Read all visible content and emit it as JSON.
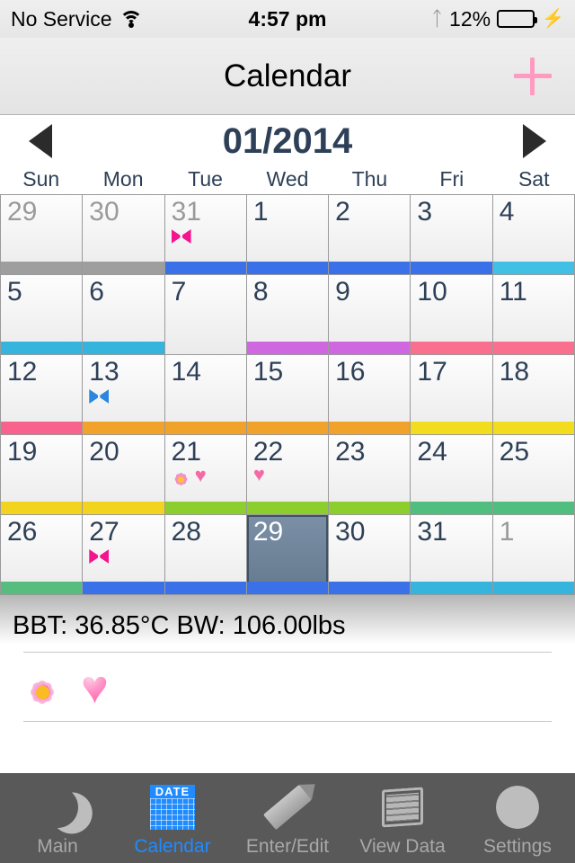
{
  "status_bar": {
    "carrier": "No Service",
    "wifi_icon": "wifi-icon",
    "time": "4:57 pm",
    "bluetooth_icon": "bluetooth-icon",
    "battery_percent": "12%",
    "battery_level": 12,
    "charging_icon": "lightning-bolt-icon"
  },
  "nav_bar": {
    "title": "Calendar",
    "add_icon": "plus-icon",
    "add_color": "#ff9bc0"
  },
  "month_header": {
    "prev_icon": "left-triangle-icon",
    "label": "01/2014",
    "next_icon": "right-triangle-icon"
  },
  "weekdays": [
    "Sun",
    "Mon",
    "Tue",
    "Wed",
    "Thu",
    "Fri",
    "Sat"
  ],
  "calendar": {
    "weeks": [
      [
        {
          "day": "29",
          "dim": true,
          "selected": false,
          "bar": "#9e9e9e",
          "marks": []
        },
        {
          "day": "30",
          "dim": true,
          "selected": false,
          "bar": "#9e9e9e",
          "marks": []
        },
        {
          "day": "31",
          "dim": true,
          "selected": false,
          "bar": "#3b71e8",
          "marks": [
            "bow-pink"
          ]
        },
        {
          "day": "1",
          "dim": false,
          "selected": false,
          "bar": "#3b71e8",
          "marks": []
        },
        {
          "day": "2",
          "dim": false,
          "selected": false,
          "bar": "#3b71e8",
          "marks": []
        },
        {
          "day": "3",
          "dim": false,
          "selected": false,
          "bar": "#3b71e8",
          "marks": []
        },
        {
          "day": "4",
          "dim": false,
          "selected": false,
          "bar": "#41bfe5",
          "marks": []
        }
      ],
      [
        {
          "day": "5",
          "dim": false,
          "selected": false,
          "bar": "#35b4dd",
          "marks": []
        },
        {
          "day": "6",
          "dim": false,
          "selected": false,
          "bar": "#35b4dd",
          "marks": []
        },
        {
          "day": "7",
          "dim": false,
          "selected": false,
          "bar": "#d濃",
          "marks": []
        },
        {
          "day": "8",
          "dim": false,
          "selected": false,
          "bar": "#cf68e0",
          "marks": []
        },
        {
          "day": "9",
          "dim": false,
          "selected": false,
          "bar": "#cf68e0",
          "marks": []
        },
        {
          "day": "10",
          "dim": false,
          "selected": false,
          "bar": "#fa6f8e",
          "marks": []
        },
        {
          "day": "11",
          "dim": false,
          "selected": false,
          "bar": "#fa6f8e",
          "marks": []
        }
      ],
      [
        {
          "day": "12",
          "dim": false,
          "selected": false,
          "bar": "#f7638d",
          "marks": []
        },
        {
          "day": "13",
          "dim": false,
          "selected": false,
          "bar": "#f0a22a",
          "marks": [
            "bow-blue"
          ]
        },
        {
          "day": "14",
          "dim": false,
          "selected": false,
          "bar": "#f0a22a",
          "marks": []
        },
        {
          "day": "15",
          "dim": false,
          "selected": false,
          "bar": "#f0a22a",
          "marks": []
        },
        {
          "day": "16",
          "dim": false,
          "selected": false,
          "bar": "#f0a22a",
          "marks": []
        },
        {
          "day": "17",
          "dim": false,
          "selected": false,
          "bar": "#f2dc1e",
          "marks": []
        },
        {
          "day": "18",
          "dim": false,
          "selected": false,
          "bar": "#f2dc1e",
          "marks": []
        }
      ],
      [
        {
          "day": "19",
          "dim": false,
          "selected": false,
          "bar": "#f2d41e",
          "marks": []
        },
        {
          "day": "20",
          "dim": false,
          "selected": false,
          "bar": "#f2d41e",
          "marks": []
        },
        {
          "day": "21",
          "dim": false,
          "selected": false,
          "bar": "#8cce2e",
          "marks": [
            "flower",
            "heart"
          ]
        },
        {
          "day": "22",
          "dim": false,
          "selected": false,
          "bar": "#8cce2e",
          "marks": [
            "heart"
          ]
        },
        {
          "day": "23",
          "dim": false,
          "selected": false,
          "bar": "#8cce2e",
          "marks": []
        },
        {
          "day": "24",
          "dim": false,
          "selected": false,
          "bar": "#4fbe7e",
          "marks": []
        },
        {
          "day": "25",
          "dim": false,
          "selected": false,
          "bar": "#4fbe7e",
          "marks": []
        }
      ],
      [
        {
          "day": "26",
          "dim": false,
          "selected": false,
          "bar": "#56bd7f",
          "marks": []
        },
        {
          "day": "27",
          "dim": false,
          "selected": false,
          "bar": "#3b71e8",
          "marks": [
            "bow-pink"
          ]
        },
        {
          "day": "28",
          "dim": false,
          "selected": false,
          "bar": "#3b71e8",
          "marks": []
        },
        {
          "day": "29",
          "dim": false,
          "selected": true,
          "bar": "#3b71e8",
          "marks": []
        },
        {
          "day": "30",
          "dim": false,
          "selected": false,
          "bar": "#3b71e8",
          "marks": []
        },
        {
          "day": "31",
          "dim": false,
          "selected": false,
          "bar": "#35b4dd",
          "marks": []
        },
        {
          "day": "1",
          "dim": true,
          "selected": false,
          "bar": "#35b4dd",
          "marks": []
        }
      ]
    ]
  },
  "detail": {
    "summary": "BBT: 36.85°C  BW: 106.00lbs",
    "icons": [
      "flower",
      "heart"
    ]
  },
  "tab_bar": {
    "items": [
      {
        "label": "Main",
        "icon": "moon-icon",
        "active": false
      },
      {
        "label": "Calendar",
        "icon": "calendar-date-icon",
        "active": true
      },
      {
        "label": "Enter/Edit",
        "icon": "pencil-icon",
        "active": false
      },
      {
        "label": "View Data",
        "icon": "document-scroll-icon",
        "active": false
      },
      {
        "label": "Settings",
        "icon": "gear-icon",
        "active": false
      }
    ],
    "calendar_icon_text": "DATE"
  }
}
